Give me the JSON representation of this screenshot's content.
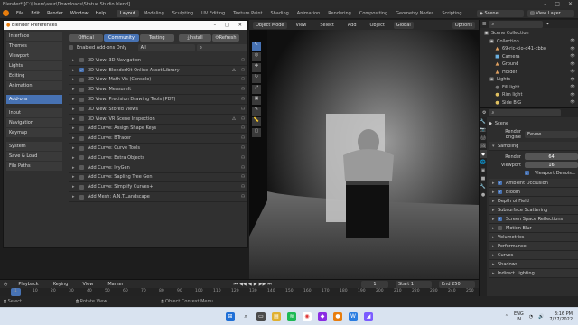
{
  "window": {
    "title": "Blender* [C:\\Users\\asur\\Downloads\\Statue Studio.blend]"
  },
  "menubar": {
    "menus": [
      "File",
      "Edit",
      "Render",
      "Window",
      "Help"
    ],
    "workspaces": [
      "Layout",
      "Modeling",
      "Sculpting",
      "UV Editing",
      "Texture Paint",
      "Shading",
      "Animation",
      "Rendering",
      "Compositing",
      "Geometry Nodes",
      "Scripting"
    ],
    "active_workspace": "Layout",
    "scene": "Scene",
    "view_layer": "View Layer"
  },
  "preferences": {
    "title": "Blender Preferences",
    "sidebar": [
      {
        "label": "Interface",
        "active": false
      },
      {
        "label": "Themes",
        "active": false
      },
      {
        "label": "Viewport",
        "active": false
      },
      {
        "label": "Lights",
        "active": false
      },
      {
        "label": "Editing",
        "active": false
      },
      {
        "label": "Animation",
        "active": false
      },
      {
        "label": "Add-ons",
        "active": true
      },
      {
        "label": "Input",
        "active": false
      },
      {
        "label": "Navigation",
        "active": false
      },
      {
        "label": "Keymap",
        "active": false
      },
      {
        "label": "System",
        "active": false
      },
      {
        "label": "Save & Load",
        "active": false
      },
      {
        "label": "File Paths",
        "active": false
      }
    ],
    "categories": [
      "Official",
      "Community",
      "Testing"
    ],
    "install_label": "Install",
    "refresh_label": "Refresh",
    "enabled_only_label": "Enabled Add-ons Only",
    "filter_value": "All",
    "addons": [
      {
        "label": "3D View: 3D Navigation",
        "enabled": false
      },
      {
        "label": "3D View: BlenderKit Online Asset Library",
        "enabled": true
      },
      {
        "label": "3D View: Math Vis (Console)",
        "enabled": false
      },
      {
        "label": "3D View: MeasureIt",
        "enabled": false
      },
      {
        "label": "3D View: Precision Drawing Tools (PDT)",
        "enabled": false
      },
      {
        "label": "3D View: Stored Views",
        "enabled": false
      },
      {
        "label": "3D View: VR Scene Inspection",
        "enabled": false
      },
      {
        "label": "Add Curve: Assign Shape Keys",
        "enabled": false
      },
      {
        "label": "Add Curve: BTracer",
        "enabled": false
      },
      {
        "label": "Add Curve: Curve Tools",
        "enabled": false
      },
      {
        "label": "Add Curve: Extra Objects",
        "enabled": false
      },
      {
        "label": "Add Curve: IvyGen",
        "enabled": false
      },
      {
        "label": "Add Curve: Sapling Tree Gen",
        "enabled": false
      },
      {
        "label": "Add Curve: Simplify Curves+",
        "enabled": false
      },
      {
        "label": "Add Mesh: A.N.T.Landscape",
        "enabled": false
      }
    ]
  },
  "viewport": {
    "mode": "Object Mode",
    "menus": [
      "View",
      "Select",
      "Add",
      "Object"
    ],
    "transform": "Global",
    "options_label": "Options"
  },
  "outliner": {
    "rows": [
      {
        "label": "Scene Collection",
        "indent": 0,
        "icon": "▣",
        "color": "#cfcfcf"
      },
      {
        "label": "Collection",
        "indent": 1,
        "icon": "▣",
        "color": "#cfcfcf"
      },
      {
        "label": "69-ric-kio-d41-cbbo",
        "indent": 2,
        "icon": "▲",
        "color": "#e0a060"
      },
      {
        "label": "Camera",
        "indent": 2,
        "icon": "■",
        "color": "#6ab0e0"
      },
      {
        "label": "Ground",
        "indent": 2,
        "icon": "▲",
        "color": "#e0a060"
      },
      {
        "label": "Holder",
        "indent": 2,
        "icon": "▲",
        "color": "#e0a060"
      },
      {
        "label": "Lights",
        "indent": 1,
        "icon": "▣",
        "color": "#cfcfcf"
      },
      {
        "label": "Fill light",
        "indent": 2,
        "icon": "●",
        "color": "#777777"
      },
      {
        "label": "Rim light",
        "indent": 2,
        "icon": "●",
        "color": "#e0c060"
      },
      {
        "label": "Side BIG",
        "indent": 2,
        "icon": "●",
        "color": "#e0c060"
      }
    ]
  },
  "properties": {
    "scene_label": "Scene",
    "render_engine_label": "Render Engine",
    "render_engine": "Eevee",
    "sampling_label": "Sampling",
    "render_label": "Render",
    "render_samples": "64",
    "viewport_label": "Viewport",
    "viewport_samples": "16",
    "denoise_label": "Viewport Denois...",
    "panels": [
      {
        "label": "Ambient Occlusion",
        "checkbox": true,
        "checked": true
      },
      {
        "label": "Bloom",
        "checkbox": true,
        "checked": true
      },
      {
        "label": "Depth of Field",
        "checkbox": false,
        "checked": false
      },
      {
        "label": "Subsurface Scattering",
        "checkbox": false,
        "checked": false
      },
      {
        "label": "Screen Space Reflections",
        "checkbox": true,
        "checked": true
      },
      {
        "label": "Motion Blur",
        "checkbox": true,
        "checked": false
      },
      {
        "label": "Volumetrics",
        "checkbox": false,
        "checked": false
      },
      {
        "label": "Performance",
        "checkbox": false,
        "checked": false
      },
      {
        "label": "Curves",
        "checkbox": false,
        "checked": false
      },
      {
        "label": "Shadows",
        "checkbox": false,
        "checked": false
      },
      {
        "label": "Indirect Lighting",
        "checkbox": false,
        "checked": false
      }
    ]
  },
  "timeline": {
    "menus": [
      "Playback",
      "Keying",
      "View",
      "Marker"
    ],
    "current_frame": "1",
    "start_label": "Start",
    "start": "1",
    "end_label": "End",
    "end": "250",
    "ruler": [
      "1",
      "10",
      "20",
      "30",
      "40",
      "50",
      "60",
      "70",
      "80",
      "90",
      "100",
      "110",
      "120",
      "130",
      "140",
      "150",
      "160",
      "170",
      "180",
      "190",
      "200",
      "210",
      "220",
      "230",
      "240",
      "250"
    ]
  },
  "statusbar": {
    "items": [
      "Select",
      "Rotate View",
      "Object Context Menu"
    ]
  },
  "taskbar": {
    "lang": "ENG",
    "region": "IN",
    "time": "3:16 PM",
    "date": "7/27/2022"
  }
}
